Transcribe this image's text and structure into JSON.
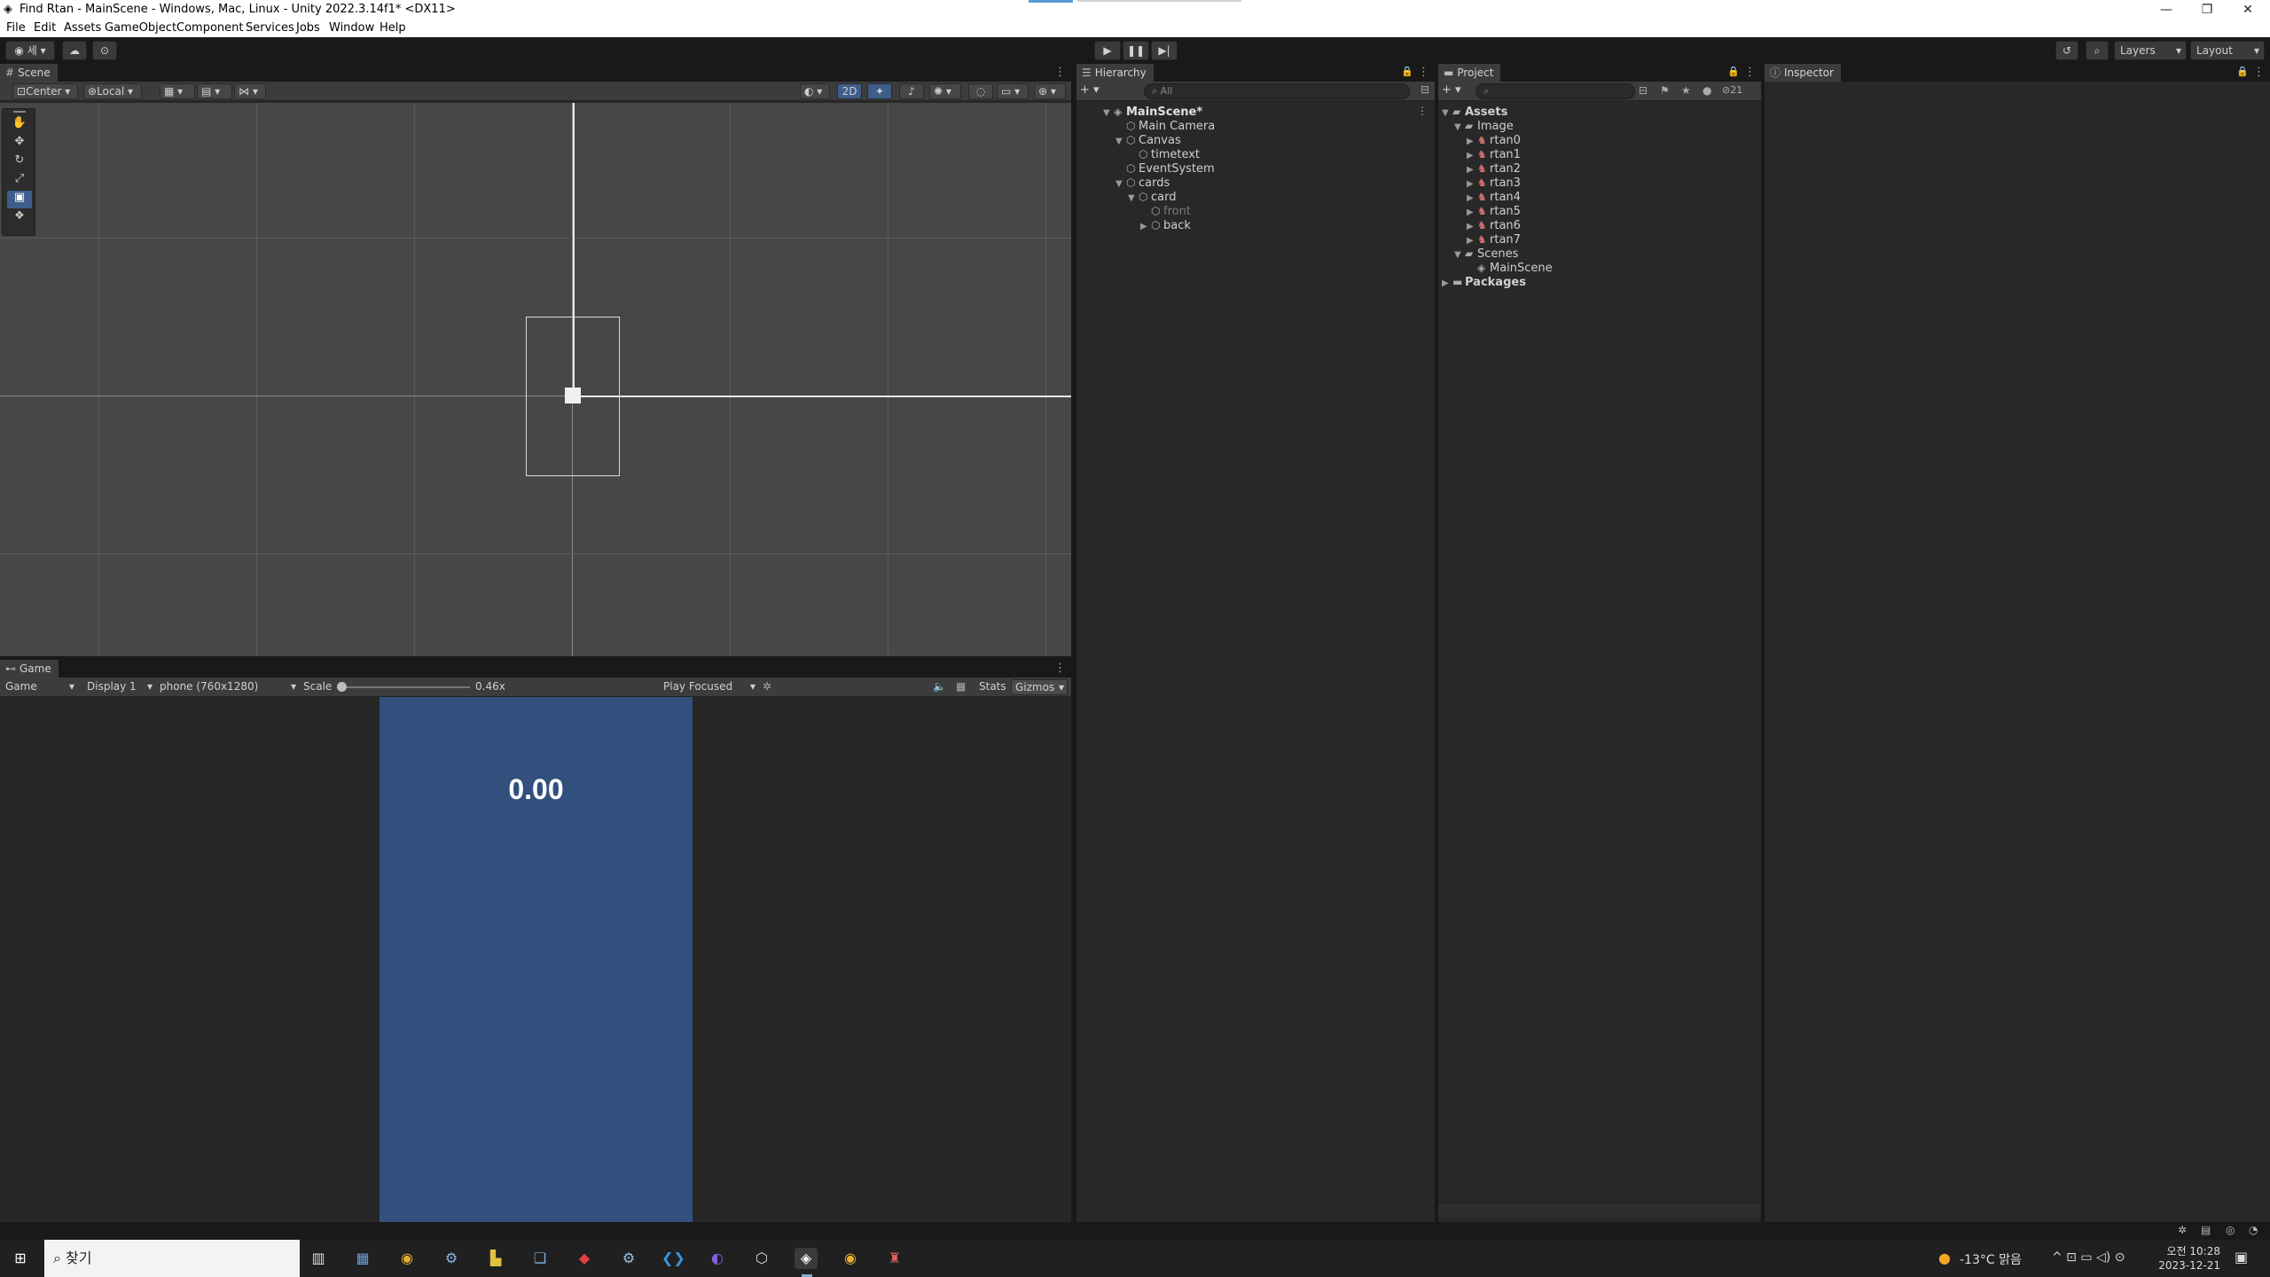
{
  "window": {
    "title": "Find Rtan - MainScene - Windows, Mac, Linux - Unity 2022.3.14f1* <DX11>"
  },
  "menu": [
    "File",
    "Edit",
    "Assets",
    "GameObject",
    "Component",
    "Services",
    "Jobs",
    "Window",
    "Help"
  ],
  "toolbar": {
    "account": "세",
    "layers": "Layers",
    "layout": "Layout"
  },
  "scene": {
    "tab": "Scene",
    "pivot": "Center",
    "space": "Local",
    "mode2d": "2D"
  },
  "game": {
    "tab": "Game",
    "view": "Game",
    "display": "Display 1",
    "resolution": "phone (760x1280)",
    "scale_label": "Scale",
    "scale_value": "0.46x",
    "play_mode": "Play Focused",
    "stats": "Stats",
    "gizmos": "Gizmos",
    "timer": "0.00"
  },
  "hierarchy": {
    "tab": "Hierarchy",
    "search_placeholder": "All",
    "items": [
      "MainScene*",
      "Main Camera",
      "Canvas",
      "timetext",
      "EventSystem",
      "cards",
      "card",
      "front",
      "back"
    ]
  },
  "project": {
    "tab": "Project",
    "hidden_count": "21",
    "items": [
      "Assets",
      "Image",
      "rtan0",
      "rtan1",
      "rtan2",
      "rtan3",
      "rtan4",
      "rtan5",
      "rtan6",
      "rtan7",
      "Scenes",
      "MainScene",
      "Packages"
    ]
  },
  "inspector": {
    "tab": "Inspector"
  },
  "taskbar": {
    "search": "찾기",
    "weather": "-13°C 맑음",
    "time": "오전 10:28",
    "date": "2023-12-21"
  },
  "colors": {
    "game_bg": "#31507e",
    "editor_bg": "#282828",
    "grid": "#5a5a5a"
  }
}
